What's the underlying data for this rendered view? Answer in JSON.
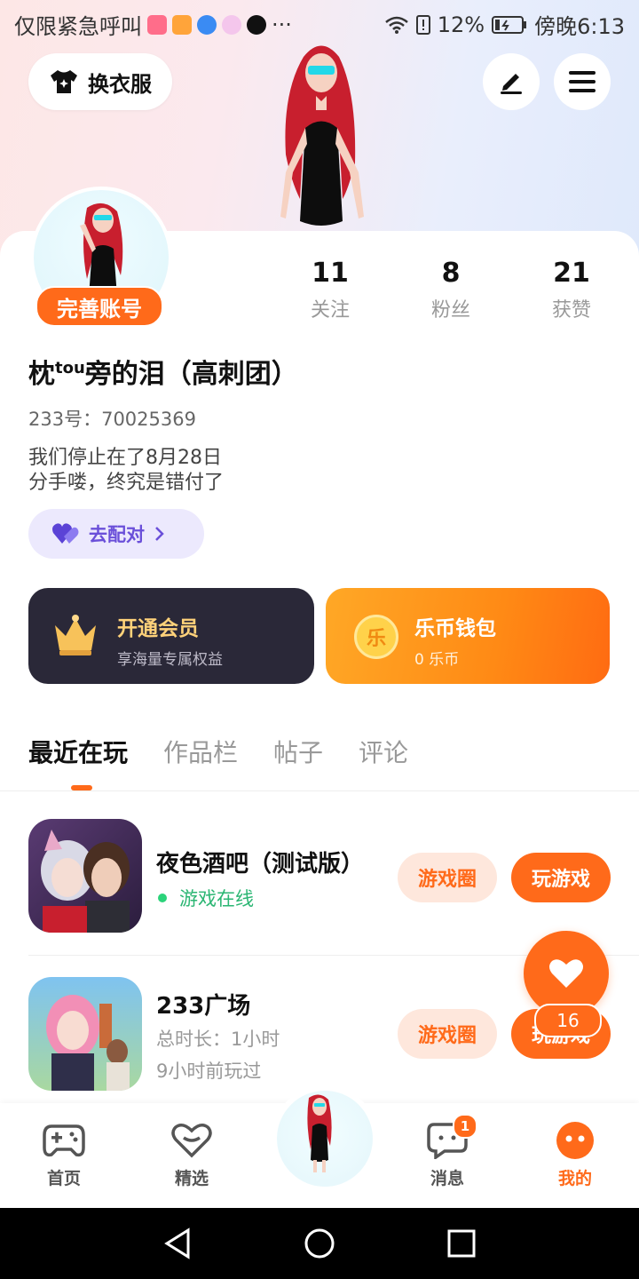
{
  "status_bar": {
    "carrier": "仅限紧急呼叫",
    "more": "···",
    "battery": "12%",
    "time": "傍晚6:13"
  },
  "header": {
    "outfit_label": "换衣服",
    "edit_icon": "pencil-icon",
    "menu_icon": "hamburger-menu-icon"
  },
  "profile": {
    "complete_badge": "完善账号",
    "stats": [
      {
        "value": "11",
        "label": "关注"
      },
      {
        "value": "8",
        "label": "粉丝"
      },
      {
        "value": "21",
        "label": "获赞"
      }
    ],
    "name_prefix": "枕",
    "name_super": "tou",
    "name_suffix": "旁的泪（高刺团）",
    "uid": "233号：70025369",
    "bio_line1": "我们停止在了8月28日",
    "bio_line2": "分手喽，终究是错付了",
    "pair_label": "去配对"
  },
  "cards": {
    "vip_title": "开通会员",
    "vip_sub": "享海量专属权益",
    "wallet_title": "乐币钱包",
    "wallet_sub": "0 乐币",
    "wallet_coin_char": "乐"
  },
  "tabs": [
    "最近在玩",
    "作品栏",
    "帖子",
    "评论"
  ],
  "games": [
    {
      "title": "夜色酒吧（测试版）",
      "status": "游戏在线",
      "circle_btn": "游戏圈",
      "play_btn": "玩游戏"
    },
    {
      "title": "233广场",
      "duration": "总时长：1小时",
      "last_played": "9小时前玩过",
      "circle_btn": "游戏圈",
      "play_btn": "玩游戏"
    }
  ],
  "fab": {
    "count": "16"
  },
  "bottom_nav": {
    "home": "首页",
    "featured": "精选",
    "messages": "消息",
    "messages_badge": "1",
    "mine": "我的"
  },
  "colors": {
    "accent": "#ff6a1a",
    "vip_bg": "#2a2838",
    "online": "#2bb673",
    "pair": "#6a4fd9"
  }
}
